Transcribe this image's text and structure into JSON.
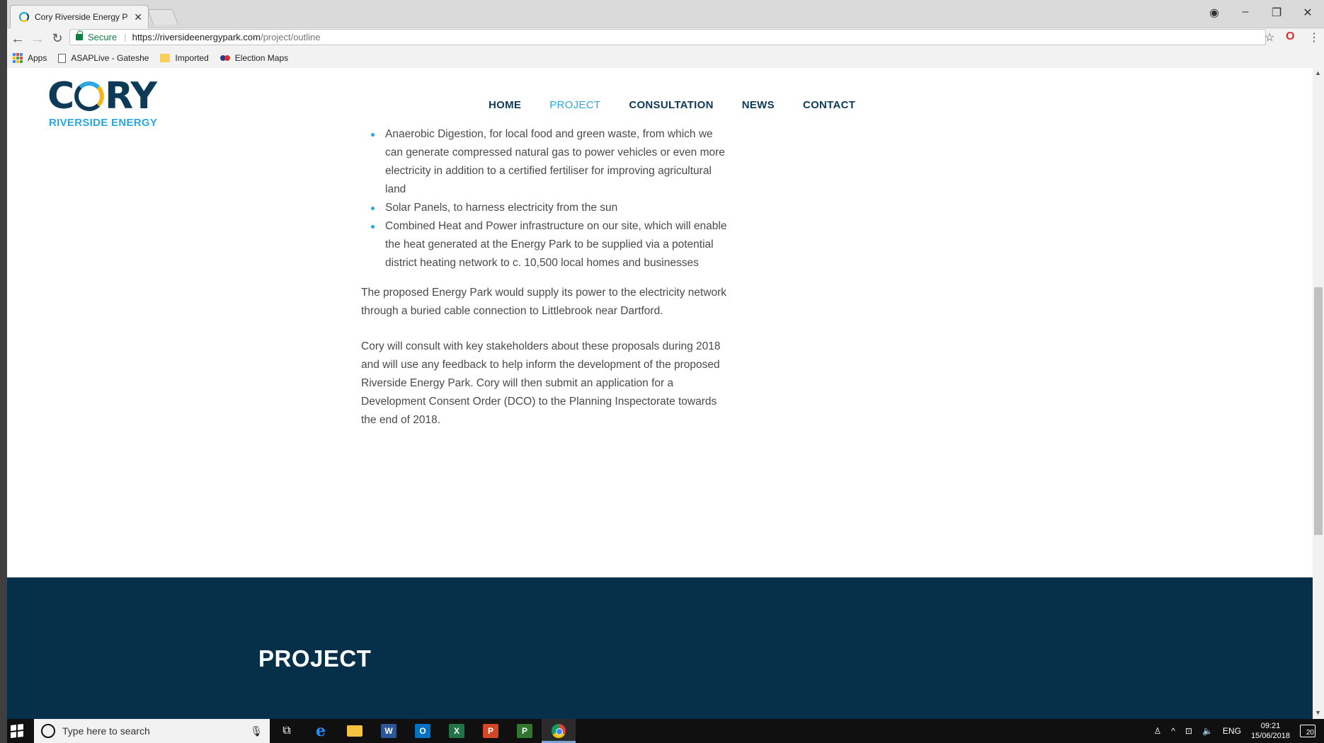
{
  "browser": {
    "tab_title": "Cory Riverside Energy Par",
    "tab_close": "✕",
    "secure_label": "Secure",
    "url_host": "https://riversideenergypark.com",
    "url_path": "/project/outline",
    "bookmarks": [
      "Apps",
      "ASAPLive - Gateshe",
      "Imported",
      "Election Maps"
    ]
  },
  "site": {
    "logo_word_left": "C",
    "logo_word_right": "RY",
    "logo_sub": "RIVERSIDE ENERGY",
    "nav": [
      "HOME",
      "PROJECT",
      "CONSULTATION",
      "NEWS",
      "CONTACT"
    ],
    "active_nav": "PROJECT"
  },
  "content": {
    "bullets": [
      "Anaerobic Digestion, for local food and green waste, from which we can generate compressed natural gas to power vehicles or even more electricity in addition to a certified fertiliser for improving agricultural land",
      "Solar Panels, to harness electricity from the sun",
      "Combined Heat and Power infrastructure on our site, which will enable the heat generated at the Energy Park to be supplied via a potential district heating network to c. 10,500 local homes and businesses"
    ],
    "paragraphs": [
      "The proposed Energy Park would supply its power to the electricity network through a buried cable connection to Littlebrook near Dartford.",
      "Cory will consult with key stakeholders about these proposals during 2018 and will use any feedback to help inform the development of the proposed Riverside Energy Park. Cory will then submit an application for a Development Consent Order (DCO) to the Planning Inspectorate towards the end of 2018."
    ],
    "footer_title": "PROJECT"
  },
  "taskbar": {
    "search_placeholder": "Type here to search",
    "apps": [
      {
        "name": "word",
        "letter": "W",
        "color": "#2b579a"
      },
      {
        "name": "outlook",
        "letter": "O",
        "color": "#0072c6"
      },
      {
        "name": "excel",
        "letter": "X",
        "color": "#217346"
      },
      {
        "name": "powerpoint",
        "letter": "P",
        "color": "#d24726"
      },
      {
        "name": "project",
        "letter": "P",
        "color": "#31752f"
      }
    ],
    "language": "ENG",
    "time": "09:21",
    "date": "15/06/2018",
    "notification_count": "20"
  }
}
